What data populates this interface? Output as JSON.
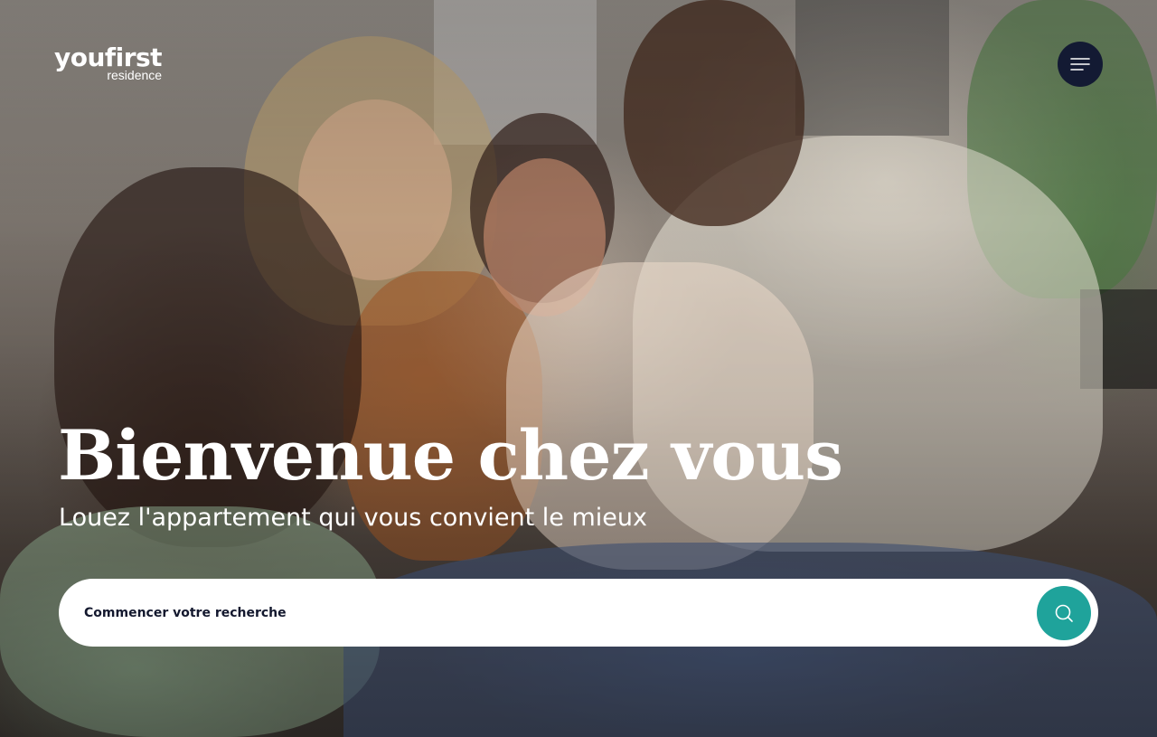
{
  "header": {
    "logo": {
      "main": "youfirst",
      "sub": "residence"
    },
    "menu_icon": "hamburger-menu-icon"
  },
  "hero": {
    "title": "Bienvenue chez vous",
    "subtitle": "Louez l'appartement qui vous convient le mieux"
  },
  "search": {
    "placeholder": "Commencer votre recherche",
    "value": "",
    "button_icon": "search-icon"
  },
  "colors": {
    "menu_button": "#131a33",
    "search_button": "#1fa39b",
    "text_light": "#ffffff",
    "text_dark": "#13182e"
  }
}
